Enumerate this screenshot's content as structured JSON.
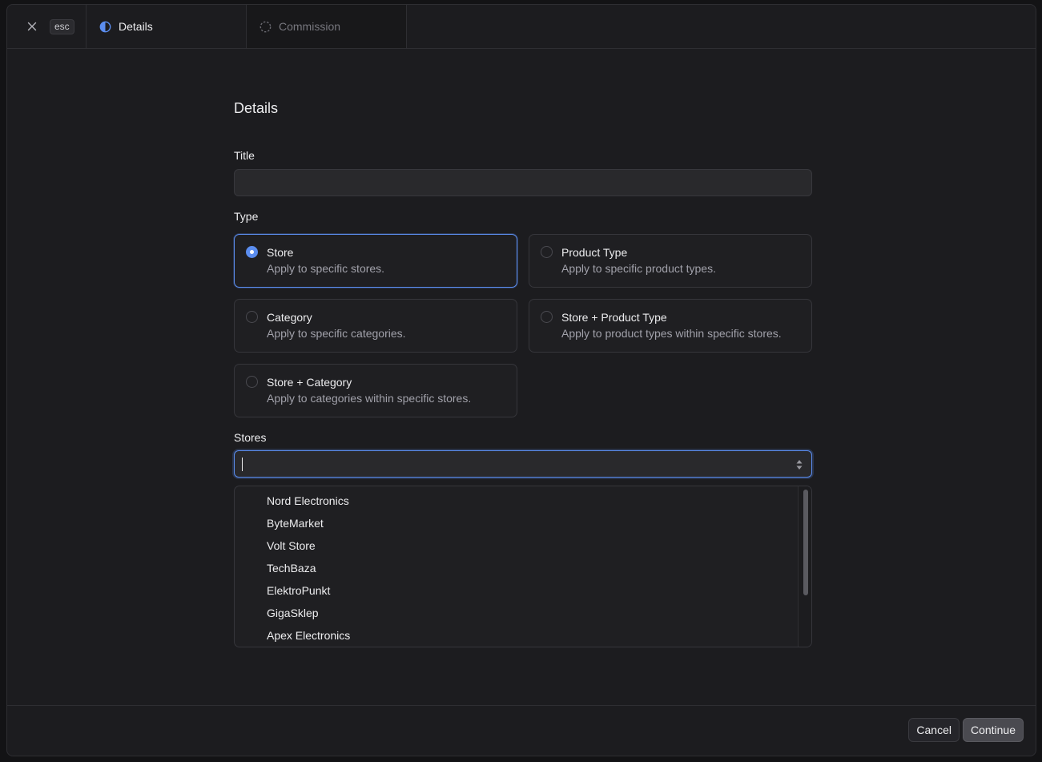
{
  "topbar": {
    "esc_label": "esc",
    "tabs": [
      {
        "label": "Details",
        "icon": "half-circle-icon",
        "active": true
      },
      {
        "label": "Commission",
        "icon": "dashed-circle-icon",
        "active": false
      }
    ]
  },
  "form": {
    "heading": "Details",
    "title_label": "Title",
    "title_value": "",
    "type_label": "Type",
    "types": [
      {
        "title": "Store",
        "description": "Apply to specific stores.",
        "selected": true
      },
      {
        "title": "Product Type",
        "description": "Apply to specific product types.",
        "selected": false
      },
      {
        "title": "Category",
        "description": "Apply to specific categories.",
        "selected": false
      },
      {
        "title": "Store + Product Type",
        "description": "Apply to product types within specific stores.",
        "selected": false
      },
      {
        "title": "Store + Category",
        "description": "Apply to categories within specific stores.",
        "selected": false
      }
    ],
    "stores_label": "Stores",
    "stores_value": "",
    "store_options": [
      "Nord Electronics",
      "ByteMarket",
      "Volt Store",
      "TechBaza",
      "ElektroPunkt",
      "GigaSklep",
      "Apex Electronics"
    ]
  },
  "footer": {
    "cancel_label": "Cancel",
    "continue_label": "Continue"
  },
  "colors": {
    "accent": "#5b8def",
    "background": "#1c1c1f",
    "border": "#2e2e32"
  }
}
